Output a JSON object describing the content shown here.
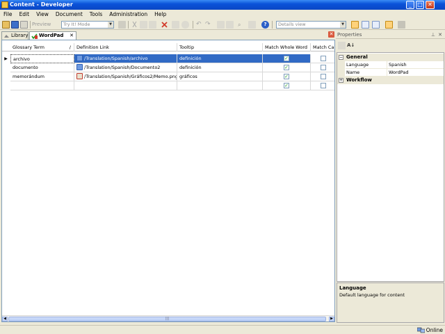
{
  "window": {
    "title": "Content - Developer"
  },
  "menu": [
    "File",
    "Edit",
    "View",
    "Document",
    "Tools",
    "Administration",
    "Help"
  ],
  "toolbar": {
    "preview_label": "Preview",
    "mode_select": "Try It! Mode",
    "view_select": "Details view"
  },
  "tabs": {
    "library": "Library",
    "wordpad": "WordPad"
  },
  "grid": {
    "columns": [
      "Glossary Term",
      "Definition Link",
      "Tooltip",
      "Match Whole Word",
      "Match Ca"
    ],
    "rows": [
      {
        "term": "archivo",
        "link": "/Translation/Spanish/archivo",
        "tooltip": "definición",
        "whole_word": true,
        "match_case": false,
        "icon": "document-link-icon"
      },
      {
        "term": "documento",
        "link": "/Translation/Spanish/Documento2",
        "tooltip": "definición",
        "whole_word": true,
        "match_case": false,
        "icon": "document-link-icon"
      },
      {
        "term": "memorándum",
        "link": "/Translation/Spanish/Gráficos2/Memo.png",
        "tooltip": "gráficos",
        "whole_word": true,
        "match_case": false,
        "icon": "image-link-icon"
      },
      {
        "term": "",
        "link": "",
        "tooltip": "",
        "whole_word": true,
        "match_case": false,
        "icon": ""
      }
    ]
  },
  "properties": {
    "title": "Properties",
    "categories": {
      "general": "General",
      "workflow": "Workflow"
    },
    "items": [
      {
        "name": "Language",
        "value": "Spanish"
      },
      {
        "name": "Name",
        "value": "WordPad"
      }
    ],
    "description_title": "Language",
    "description_text": "Default language for content"
  },
  "status": {
    "text": "Online"
  },
  "colors": {
    "selection": "#316ac5",
    "titlebar": "#0a52d9"
  }
}
